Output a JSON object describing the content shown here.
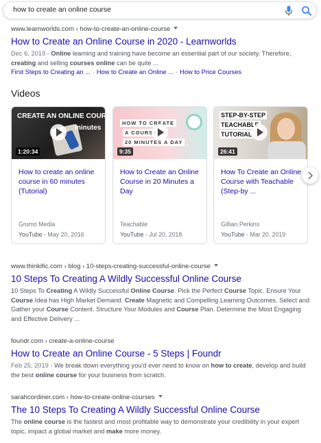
{
  "search": {
    "query": "how to create an online course"
  },
  "results": [
    {
      "cite": "www.learnworlds.com › how-to-create-an-online-course",
      "title": "How to Create an Online Course in 2020 - Learnworlds",
      "date": "Dec 6, 2019 - ",
      "snippet": [
        {
          "t": "Online",
          "b": true
        },
        {
          "t": " learning and training have become an essential part of our society. Therefore, ",
          "b": false
        },
        {
          "t": "creating",
          "b": true
        },
        {
          "t": " and selling ",
          "b": false
        },
        {
          "t": "courses online",
          "b": true
        },
        {
          "t": " can be quite ...",
          "b": false
        }
      ],
      "sitelinks": [
        "First Steps to Creating an ...",
        "How to Create an Online ...",
        "How to Price Courses"
      ]
    },
    {
      "cite": "www.thinkific.com › blog › 10-steps-creating-successful-online-course",
      "title": "10 Steps To Creating A Wildly Successful Online Course",
      "snippet": [
        {
          "t": "10 Steps To ",
          "b": false
        },
        {
          "t": "Creating",
          "b": true
        },
        {
          "t": " A Wildly Successful ",
          "b": false
        },
        {
          "t": "Online Course",
          "b": true
        },
        {
          "t": ". Pick the Perfect ",
          "b": false
        },
        {
          "t": "Course",
          "b": true
        },
        {
          "t": " Topic. Ensure Your ",
          "b": false
        },
        {
          "t": "Course",
          "b": true
        },
        {
          "t": " Idea has High Market Demand. ",
          "b": false
        },
        {
          "t": "Create",
          "b": true
        },
        {
          "t": " Magnetic and Compelling Learning Outcomes. Select and Gather your ",
          "b": false
        },
        {
          "t": "Course",
          "b": true
        },
        {
          "t": " Content. Structure Your Modules and ",
          "b": false
        },
        {
          "t": "Course",
          "b": true
        },
        {
          "t": " Plan. Determine the Most Engaging and Effective Delivery ...",
          "b": false
        }
      ]
    },
    {
      "cite": "foundr.com › create-a-online-course",
      "title": "How to Create an Online Course - 5 Steps | Foundr",
      "date": "Feb 25, 2019 - ",
      "snippet": [
        {
          "t": "We break down everything you'd ever need to know on ",
          "b": false
        },
        {
          "t": "how to create",
          "b": true
        },
        {
          "t": ", develop and build the best ",
          "b": false
        },
        {
          "t": "online course",
          "b": true
        },
        {
          "t": " for your business from scratch.",
          "b": false
        }
      ]
    },
    {
      "cite": "sarahcordiner.com › how-to-create-online-courses",
      "title": "The 10 Steps To Creating A Wildly Successful Online Course",
      "snippet": [
        {
          "t": "The ",
          "b": false
        },
        {
          "t": "online course",
          "b": true
        },
        {
          "t": " is the fastest and most profitable way to demonstrate your credibility in your expert topic, impact a global market and ",
          "b": false
        },
        {
          "t": "make",
          "b": true
        },
        {
          "t": " more money.",
          "b": false
        }
      ]
    }
  ],
  "videos": {
    "heading": "Videos",
    "items": [
      {
        "duration": "1:20:34",
        "thumb_text": [
          "CREATE AN ONLINE COURSE",
          "minutes"
        ],
        "title": "How to create an online course in 60 minutes (Tutorial)",
        "channel": "Grumo Media",
        "source": "YouTube",
        "date": " - May 20, 2016"
      },
      {
        "duration": "9:35",
        "thumb_text": [
          "HOW TO CREATE",
          "A COURSE IN",
          "20 MINUTES A DAY"
        ],
        "title": "How to Create an Online Course in 20 Minutes a Day",
        "channel": "Teachable",
        "source": "YouTube",
        "date": " - Jul 20, 2018"
      },
      {
        "duration": "26:41",
        "thumb_text": [
          "STEP-BY-STEP",
          "TEACHABLE",
          "TUTORIAL"
        ],
        "title": "How To Create an Online Course with Teachable (Step-by ...",
        "channel": "Gillian Perkins",
        "source": "YouTube",
        "date": " - Mar 20, 2019"
      }
    ]
  },
  "colors": {
    "link": "#1a0dab",
    "text": "#4d5156",
    "meta": "#70757a",
    "mic_blue": "#4285f4",
    "mic_red": "#ea4335"
  }
}
